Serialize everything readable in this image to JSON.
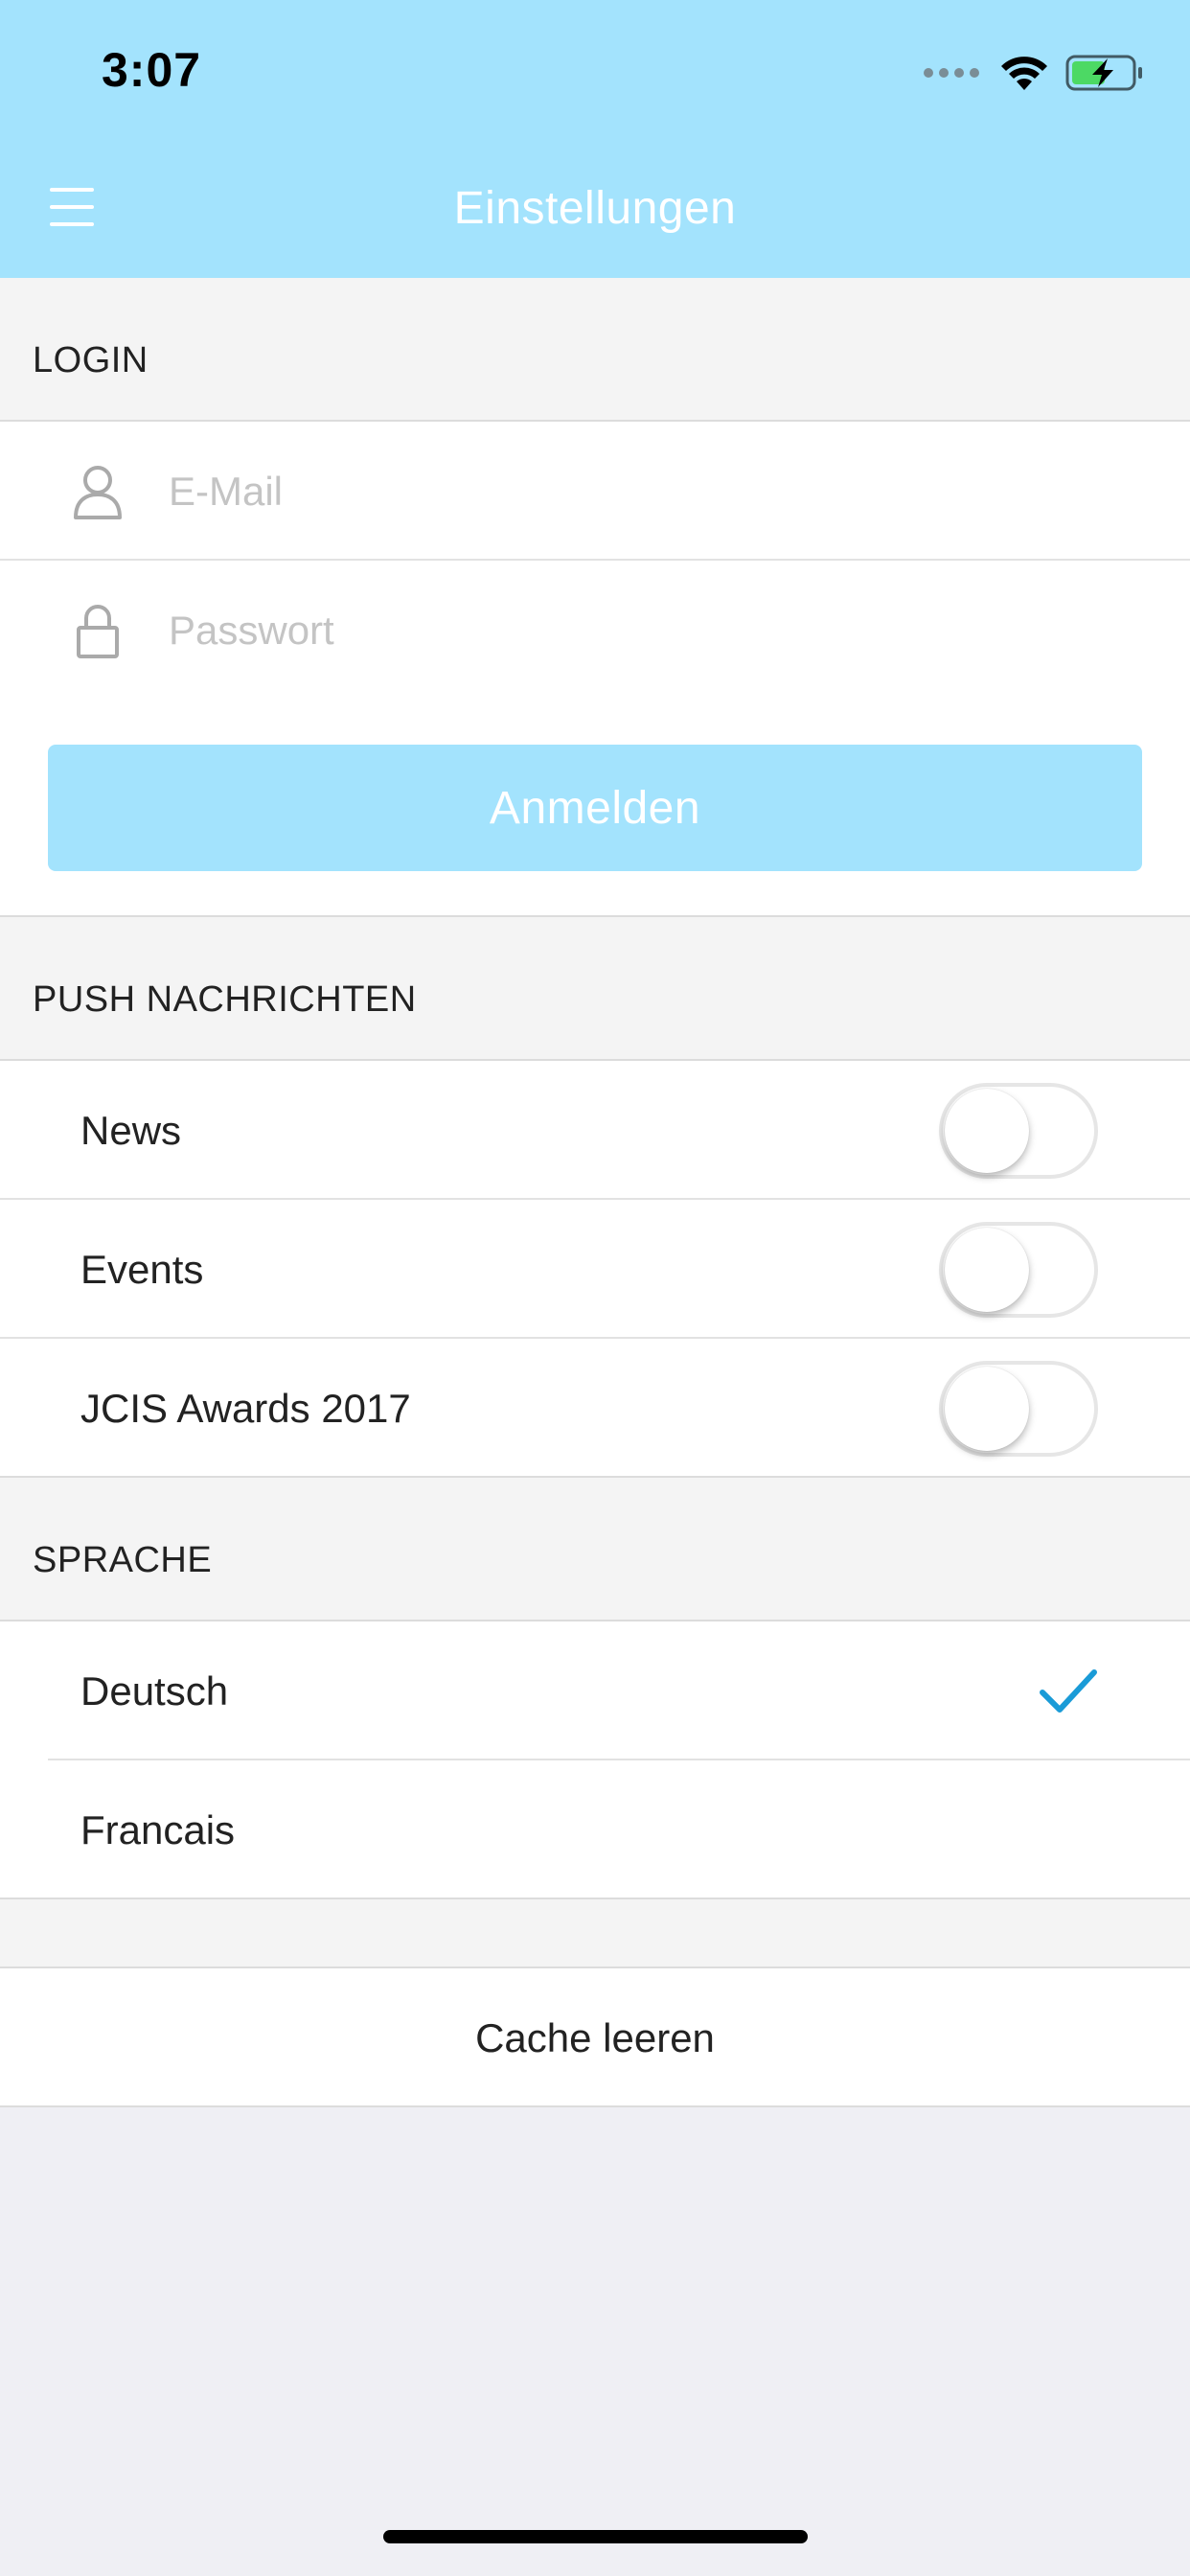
{
  "status": {
    "time": "3:07"
  },
  "header": {
    "title": "Einstellungen"
  },
  "login": {
    "section": "LOGIN",
    "email_placeholder": "E-Mail",
    "password_placeholder": "Passwort",
    "button": "Anmelden"
  },
  "push": {
    "section": "PUSH NACHRICHTEN",
    "items": [
      {
        "label": "News",
        "enabled": false
      },
      {
        "label": "Events",
        "enabled": false
      },
      {
        "label": "JCIS Awards 2017",
        "enabled": false
      }
    ]
  },
  "language": {
    "section": "SPRACHE",
    "options": [
      {
        "label": "Deutsch",
        "selected": true
      },
      {
        "label": "Francais",
        "selected": false
      }
    ]
  },
  "cache": {
    "button": "Cache leeren"
  },
  "colors": {
    "accent": "#a3e3fd",
    "check": "#1a9bd7"
  }
}
